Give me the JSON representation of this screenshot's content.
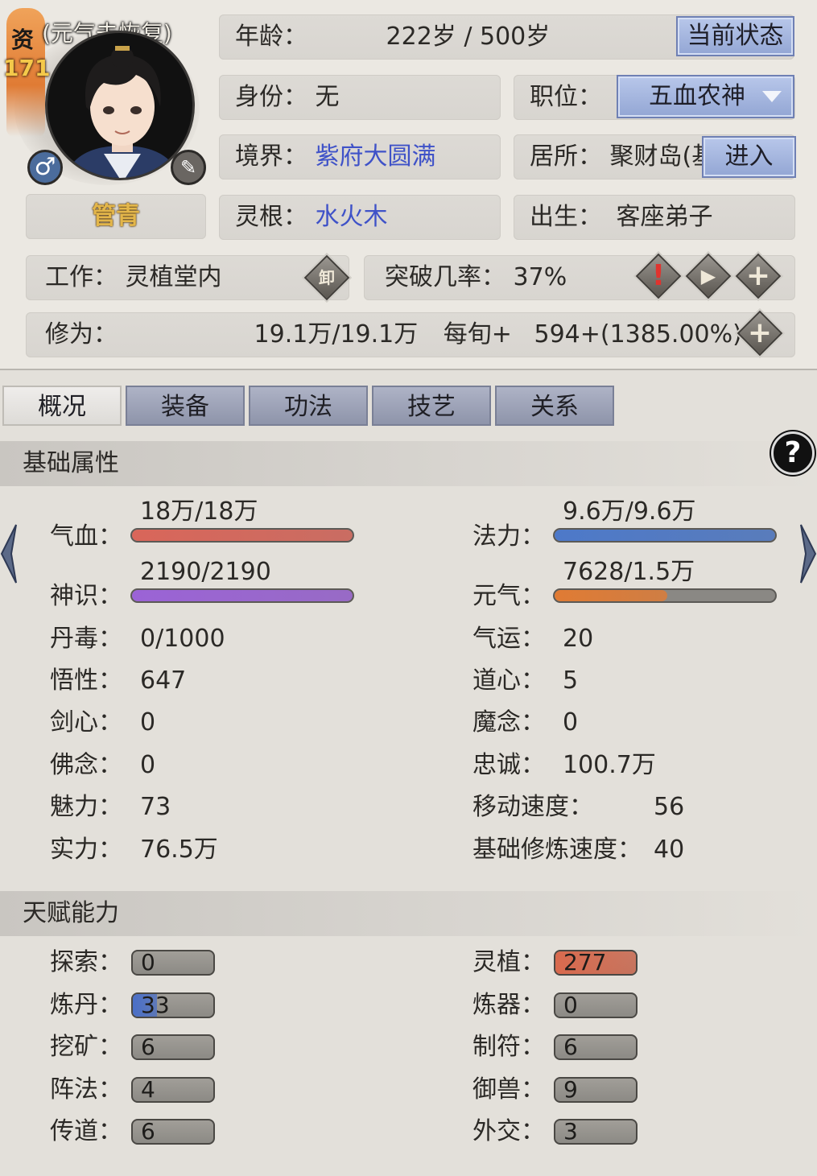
{
  "header": {
    "aptitude_char": "资",
    "aptitude_value": "171",
    "status_note": "(元气未恢复)",
    "name": "管青",
    "gender_icon": "male-symbol-icon",
    "edit_icon": "brush-icon"
  },
  "info": {
    "age_label": "年龄：",
    "age_value": "222岁 / 500岁",
    "current_status_button": "当前状态",
    "identity_label": "身份：",
    "identity_value": "无",
    "position_label": "职位：",
    "position_value": "五血农神",
    "realm_label": "境界：",
    "realm_value": "紫府大圆满",
    "residence_label": "居所：",
    "residence_value": "聚财岛(基",
    "enter_button": "进入",
    "root_label": "灵根：",
    "root_value": "水火木",
    "birth_label": "出生：",
    "birth_value": "客座弟子",
    "work_label": "工作：",
    "work_value": "灵植堂内",
    "unequip_label": "卸",
    "breakthrough_label": "突破几率：",
    "breakthrough_value": "37%",
    "cultivation_label": "修为：",
    "cultivation_value": "19.1万/19.1万",
    "per_turn_label": "每旬+",
    "per_turn_value": "594+(1385.00%)"
  },
  "tabs": [
    {
      "label": "概况",
      "active": true
    },
    {
      "label": "装备",
      "active": false
    },
    {
      "label": "功法",
      "active": false
    },
    {
      "label": "技艺",
      "active": false
    },
    {
      "label": "关系",
      "active": false
    }
  ],
  "basic": {
    "title": "基础属性",
    "help_icon": "question-mark-icon",
    "hp_label": "气血：",
    "hp_value": "18万/18万",
    "hp_fraction": 1.0,
    "hp_color": "#d9665a",
    "mana_label": "法力：",
    "mana_value": "9.6万/9.6万",
    "mana_fraction": 1.0,
    "mana_color": "#4d79c9",
    "sense_label": "神识：",
    "sense_value": "2190/2190",
    "sense_fraction": 1.0,
    "sense_color": "#9b63d6",
    "vital_label": "元气：",
    "vital_value": "7628/1.5万",
    "vital_fraction": 0.51,
    "vital_color": "#e07b34",
    "stats_left": [
      {
        "label": "丹毒：",
        "value": "0/1000"
      },
      {
        "label": "悟性：",
        "value": "647"
      },
      {
        "label": "剑心：",
        "value": "0"
      },
      {
        "label": "佛念：",
        "value": "0"
      },
      {
        "label": "魅力：",
        "value": "73"
      },
      {
        "label": "实力：",
        "value": "76.5万"
      }
    ],
    "stats_right": [
      {
        "label": "气运：",
        "value": "20"
      },
      {
        "label": "道心：",
        "value": "5"
      },
      {
        "label": "魔念：",
        "value": "0"
      },
      {
        "label": "忠诚：",
        "value": "100.7万"
      },
      {
        "label": "移动速度：",
        "value": "56"
      },
      {
        "label": "基础修炼速度：",
        "value": "40"
      }
    ]
  },
  "talents": {
    "title": "天赋能力",
    "left": [
      {
        "label": "探索：",
        "value": "0",
        "level": 0,
        "color": "#8c8a85"
      },
      {
        "label": "炼丹：",
        "value": "33",
        "level": 0.3,
        "color": "#4a6fc7"
      },
      {
        "label": "挖矿：",
        "value": "6",
        "level": 0,
        "color": "#8c8a85"
      },
      {
        "label": "阵法：",
        "value": "4",
        "level": 0,
        "color": "#8c8a85"
      },
      {
        "label": "传道：",
        "value": "6",
        "level": 0,
        "color": "#8c8a85"
      }
    ],
    "right": [
      {
        "label": "灵植：",
        "value": "277",
        "level": 1.0,
        "color": "#d96a4e"
      },
      {
        "label": "炼器：",
        "value": "0",
        "level": 0,
        "color": "#8c8a85"
      },
      {
        "label": "制符：",
        "value": "6",
        "level": 0,
        "color": "#8c8a85"
      },
      {
        "label": "御兽：",
        "value": "9",
        "level": 0,
        "color": "#8c8a85"
      },
      {
        "label": "外交：",
        "value": "3",
        "level": 0,
        "color": "#8c8a85"
      }
    ]
  }
}
